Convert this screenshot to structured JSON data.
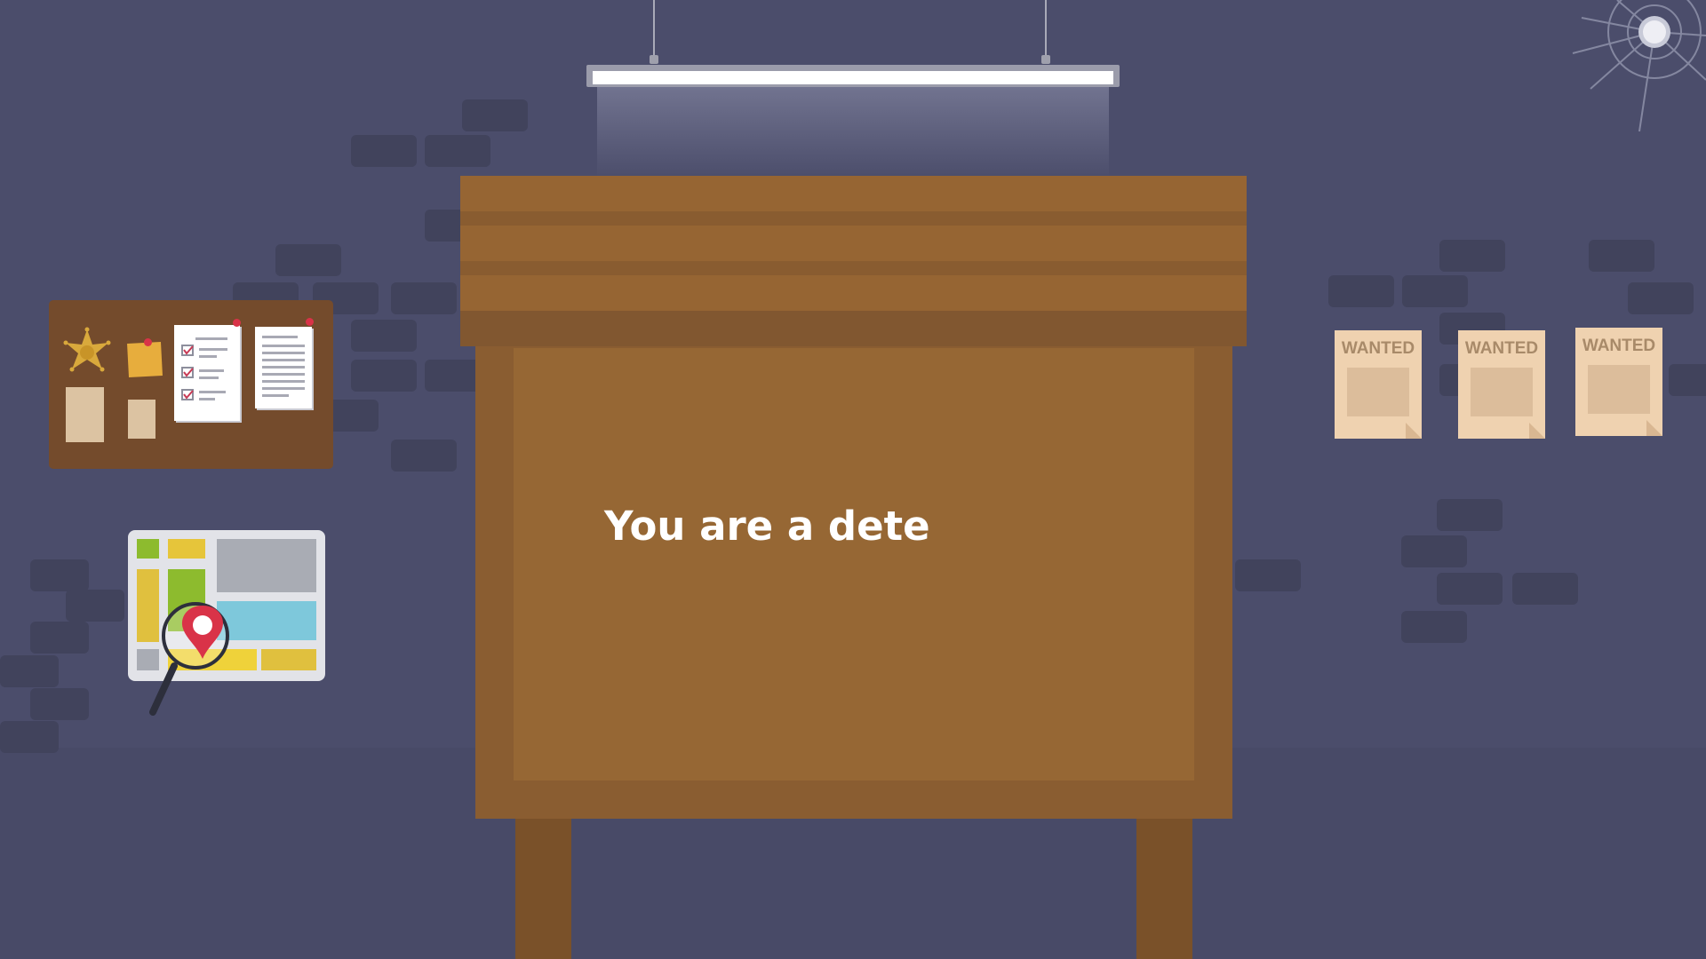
{
  "dialog": {
    "text": "You are a dete"
  },
  "wanted_posters": [
    {
      "label": "WANTED"
    },
    {
      "label": "WANTED"
    },
    {
      "label": "WANTED"
    }
  ],
  "colors": {
    "wall": "#4b4d6b",
    "board_wood": "#966533",
    "panel_wood": "#966734",
    "poster": "#efd2b0",
    "text": "#ffffff"
  },
  "icons": [
    "ceiling-lamp-icon",
    "sheriff-star-icon",
    "sticky-note-icon",
    "checklist-icon",
    "document-icon",
    "map-icon",
    "magnifier-pin-icon",
    "bullet-hole-icon"
  ]
}
